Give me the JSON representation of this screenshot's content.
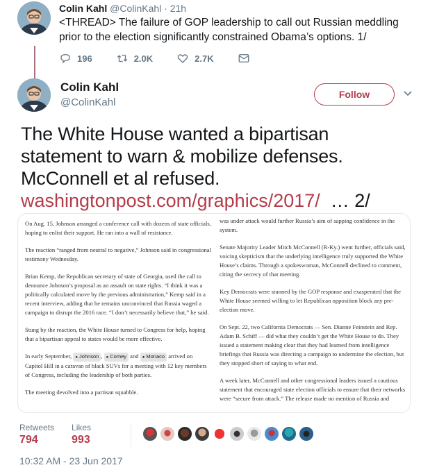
{
  "tweet1": {
    "author_name": "Colin Kahl",
    "author_handle": "@ColinKahl",
    "separator": "·",
    "time": "21h",
    "text": "<THREAD> The failure of GOP leadership to call out Russian meddling prior to the election significantly constrained Obama’s  options. 1/",
    "reply_count": "196",
    "retweet_count": "2.0K",
    "like_count": "2.7K"
  },
  "tweet2": {
    "author_name": "Colin Kahl",
    "author_handle": "@ColinKahl",
    "follow_label": "Follow",
    "text": "The White House wanted a bipartisan statement to warn & mobilize defenses. McConnell et al refused.",
    "link_text": "washingtonpost.com/graphics/2017/",
    "link_suffix": "  … 2/",
    "article_left": [
      "On Aug. 15, Johnson arranged a conference call with dozens of state officials, hoping to enlist their support. He ran into a wall of resistance.",
      "The reaction “ranged from neutral to negative,” Johnson said in congressional testimony Wednesday.",
      "Brian Kemp, the Republican secretary of state of Georgia, used the call to denounce Johnson’s proposal as an assault on state rights. “I think it was a politically calculated move by the previous administration,” Kemp said in a recent interview, adding that he remains unconvinced that Russia waged a campaign to disrupt the 2016 race. “I don’t necessarily believe that,” he said.",
      "Stung by the reaction, the White House turned to Congress for help, hoping that a bipartisan appeal to states would be more effective."
    ],
    "article_left_p5": {
      "before": "In early September, ",
      "name1": "Johnson",
      "comma": ", ",
      "name2": "Comey",
      "and": " and ",
      "name3": "Monaco",
      "after": " arrived on Capitol Hill in a caravan of black SUVs for a meeting with 12 key members of Congress, including the leadership of both parties."
    },
    "article_left_last": "The meeting devolved into a partisan squabble.",
    "article_right": [
      "was under attack would further Russia’s aim of sapping confidence in the system.",
      "Senate Majority Leader Mitch McConnell (R-Ky.) went further, officials said, voicing skepticism that the underlying intelligence truly supported the White House’s claims. Through a spokeswoman, McConnell declined to comment, citing the secrecy of that meeting.",
      "Key Democrats were stunned by the GOP response and exasperated that the White House seemed willing to let Republican opposition block any pre-election move.",
      "On Sept. 22, two California Democrats — Sen. Dianne Feinstein and Rep. Adam B. Schiff — did what they couldn’t get the White House to do. They issued a statement making clear that they had learned from intelligence briefings that Russia was directing a campaign to undermine the election, but they stopped short of saying to what end.",
      "A week later, McConnell and other congressional leaders issued a cautious statement that encouraged state election officials to ensure that their networks were “secure from attack.” The release made no mention of Russia and"
    ],
    "retweets_label": "Retweets",
    "retweets_value": "794",
    "likes_label": "Likes",
    "likes_value": "993",
    "timestamp": "10:32 AM - 23 Jun 2017"
  },
  "colors": {
    "accent": "#b43c4b",
    "thread_line": "#a8727f",
    "muted": "#657786",
    "text": "#14171a"
  },
  "icons": [
    "reply-icon",
    "retweet-icon",
    "like-icon",
    "direct-message-icon",
    "chevron-down-icon"
  ]
}
